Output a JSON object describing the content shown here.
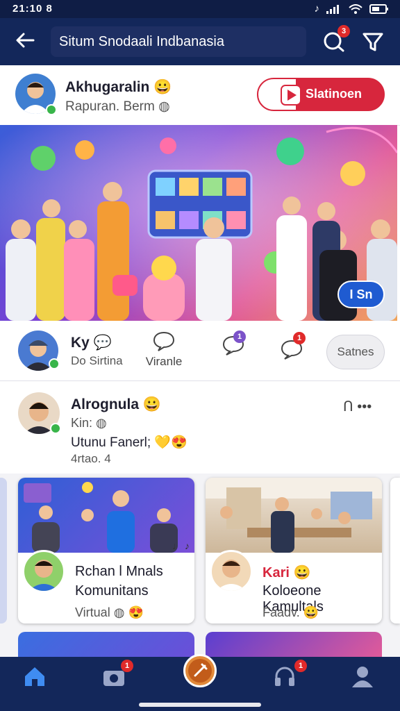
{
  "status": {
    "time": "21:10",
    "extra": "8"
  },
  "header": {
    "search_text": "Situm Snodaali Indbanasia",
    "notif_badge": "3"
  },
  "profile": {
    "name": "Akhugaralin",
    "emoji": "😀",
    "subtitle": "Rapuran. Berm",
    "live_label": "Slatinoen"
  },
  "hero": {
    "pill_label": "I Sn"
  },
  "actions": {
    "user_name": "Ky",
    "user_sub": "Do Sirtina",
    "like_label": "Viranle",
    "comment_badge": "1",
    "message_badge": "1",
    "share_label": "Satnes"
  },
  "post": {
    "name": "Alrognula",
    "emoji": "😀",
    "line1": "Kin:",
    "line2": "Utunu Fanerl;",
    "line3": "4rtao. 4",
    "more": "Ո •••"
  },
  "cards": [
    {
      "title1": "Rchan l Mnals",
      "title2": "Komunitans",
      "meta": "Virtual",
      "corner": "♩ ♪"
    },
    {
      "title1": "Kari",
      "title2": "Koloeone Kamultals",
      "meta": "Faadv.",
      "title1_color": "#d7263d"
    }
  ],
  "bottom_nav": {
    "badge1": "1",
    "badge2": "1"
  },
  "colors": {
    "navy": "#13275a",
    "accent_red": "#d7263d",
    "blue": "#1f5bd1"
  }
}
